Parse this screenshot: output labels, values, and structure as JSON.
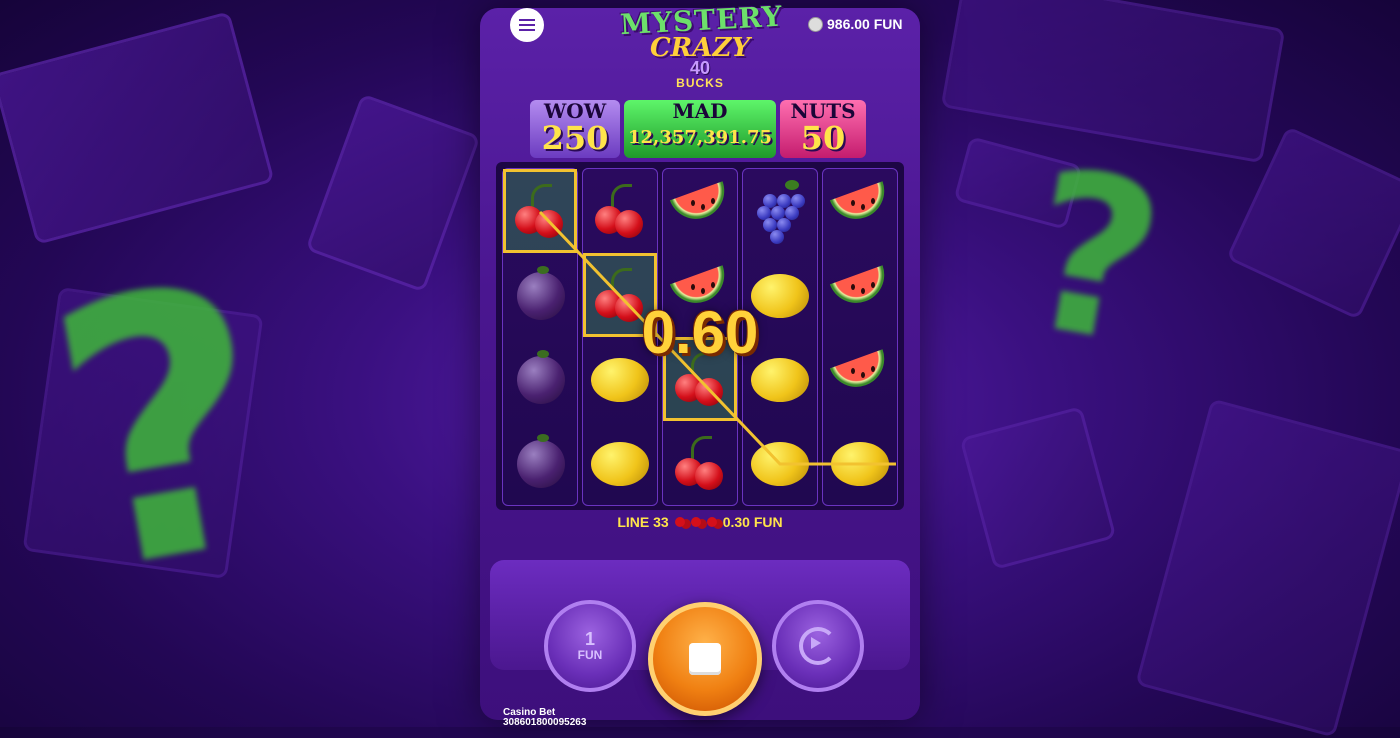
{
  "header": {
    "menu_icon": "hamburger-icon",
    "balance": "986.00 FUN",
    "balance_icon": "coins-icon"
  },
  "logo": {
    "line1": "MYSTERY",
    "line2": "CRAZY",
    "line3": "40",
    "line4": "BUCKS"
  },
  "jackpots": {
    "wow": {
      "label": "WOW",
      "value": "250"
    },
    "mad": {
      "label": "MAD",
      "value": "12,357,391.75"
    },
    "nuts": {
      "label": "NUTS",
      "value": "50"
    }
  },
  "reels": [
    [
      "cherry",
      "plum",
      "plum",
      "plum"
    ],
    [
      "cherry",
      "cherry",
      "lemon",
      "lemon"
    ],
    [
      "melon",
      "melon",
      "cherry",
      "cherry"
    ],
    [
      "grape",
      "lemon",
      "lemon",
      "lemon"
    ],
    [
      "melon",
      "melon",
      "melon",
      "lemon"
    ]
  ],
  "win": {
    "amount": "0.60",
    "line_label": "LINE 33",
    "line_amount": "0.30 FUN"
  },
  "controls": {
    "bet_value": "1",
    "bet_unit": "FUN",
    "spin_icon": "stop-icon",
    "auto_icon": "autoplay-icon"
  },
  "footer": {
    "brand": "Casino Bet",
    "round_id": "308601800095263"
  },
  "colors": {
    "accent_gold": "#ffd23a",
    "spin_orange": "#f08012",
    "background_purple": "#3a1080",
    "win_green": "#3fb83a"
  }
}
